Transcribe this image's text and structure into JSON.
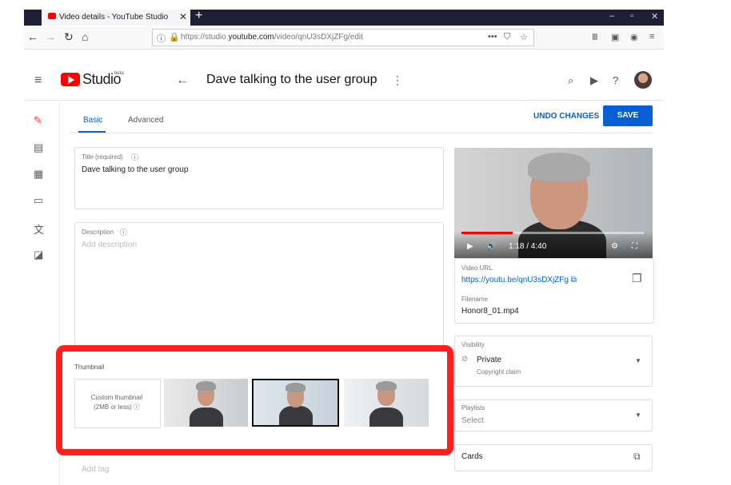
{
  "browser": {
    "tab_title": "Video details - YouTube Studio",
    "tab_close": "✕",
    "new_tab": "+",
    "url_prefix": "https://studio.",
    "url_domain": "youtube.com",
    "url_path": "/video/qnU3sDXjZFg/edit",
    "nav_icons": [
      "back-arrow",
      "forward-arrow",
      "reload",
      "home"
    ],
    "window_controls": [
      "minimize",
      "maximize",
      "close"
    ]
  },
  "header": {
    "logo_text": "Studio",
    "logo_badge": "beta",
    "video_title": "Dave talking to the user group"
  },
  "tabs": [
    {
      "label": "Basic",
      "active": true
    },
    {
      "label": "Advanced",
      "active": false
    }
  ],
  "actions": {
    "undo_label": "UNDO CHANGES",
    "save_label": "SAVE"
  },
  "form": {
    "title_label": "Title (required)",
    "title_value": "Dave talking to the user group",
    "description_label": "Description",
    "description_placeholder": "Add description",
    "thumbnail_label": "Thumbnail",
    "custom_thumb_line1": "Custom thumbnail",
    "custom_thumb_line2": "(2MB or less)",
    "tags_placeholder": "Add tag"
  },
  "video": {
    "time": "1:18 / 4:40",
    "progress": 0.28,
    "url_label": "Video URL",
    "url_value": "https://youtu.be/qnU3sDXjZFg",
    "filename_label": "Filename",
    "filename_value": "Honor8_01.mp4"
  },
  "visibility": {
    "label": "Visibility",
    "value": "Private",
    "sub": "Copyright claim"
  },
  "playlists": {
    "label": "Playlists",
    "placeholder": "Select"
  },
  "cards": {
    "label": "Cards"
  },
  "colors": {
    "accent": "#065fd4",
    "highlight": "#ff1f1f",
    "brand": "#ff0000"
  }
}
